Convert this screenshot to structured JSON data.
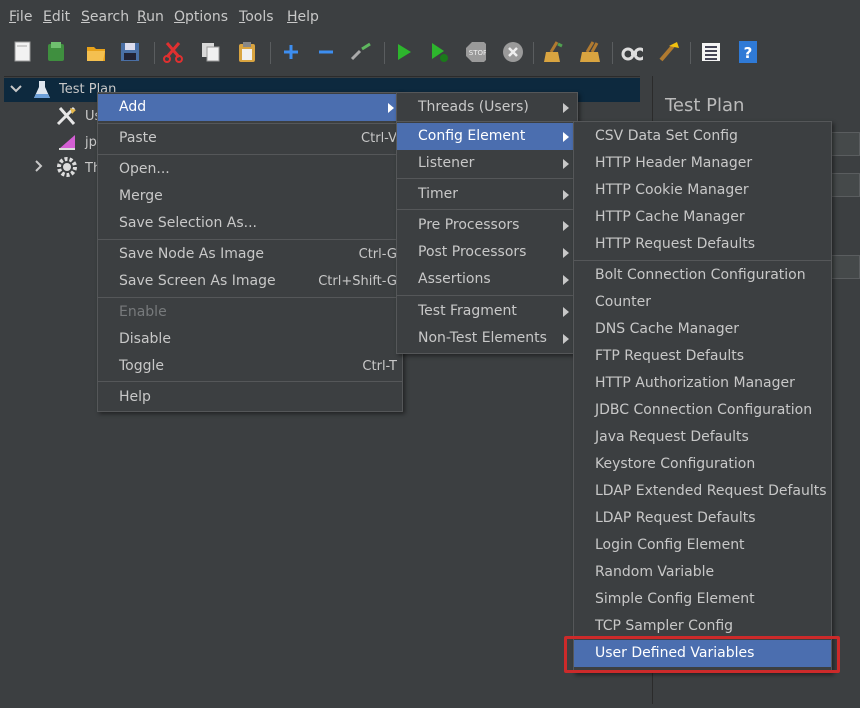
{
  "menubar": [
    "File",
    "Edit",
    "Search",
    "Run",
    "Options",
    "Tools",
    "Help"
  ],
  "toolbar_icons": [
    "new-icon",
    "templates-icon",
    "open-icon",
    "save-icon",
    "cut-icon",
    "copy-icon",
    "paste-icon",
    "expand-icon",
    "collapse-icon",
    "toggle-icon",
    "start-icon",
    "start-no-pause-icon",
    "stop-icon",
    "shutdown-icon",
    "clear-icon",
    "clear-all-icon",
    "search-icon",
    "reset-search-icon",
    "function-helper-icon",
    "help-icon"
  ],
  "tree": {
    "root": "Test Plan",
    "child1": "Us",
    "child2": "jp",
    "child3": "Th"
  },
  "right_pane": {
    "title": "Test Plan"
  },
  "context_menu": [
    {
      "label": "Add",
      "shortcut": "",
      "submenu": true,
      "highlight": true,
      "disabled": false
    },
    {
      "label": "Paste",
      "shortcut": "Ctrl-V",
      "submenu": false,
      "highlight": false,
      "disabled": false
    },
    {
      "label": "Open...",
      "shortcut": "",
      "submenu": false,
      "highlight": false,
      "disabled": false
    },
    {
      "label": "Merge",
      "shortcut": "",
      "submenu": false,
      "highlight": false,
      "disabled": false
    },
    {
      "label": "Save Selection As...",
      "shortcut": "",
      "submenu": false,
      "highlight": false,
      "disabled": false
    },
    {
      "label": "Save Node As Image",
      "shortcut": "Ctrl-G",
      "submenu": false,
      "highlight": false,
      "disabled": false
    },
    {
      "label": "Save Screen As Image",
      "shortcut": "Ctrl+Shift-G",
      "submenu": false,
      "highlight": false,
      "disabled": false
    },
    {
      "label": "Enable",
      "shortcut": "",
      "submenu": false,
      "highlight": false,
      "disabled": true
    },
    {
      "label": "Disable",
      "shortcut": "",
      "submenu": false,
      "highlight": false,
      "disabled": false
    },
    {
      "label": "Toggle",
      "shortcut": "Ctrl-T",
      "submenu": false,
      "highlight": false,
      "disabled": false
    },
    {
      "label": "Help",
      "shortcut": "",
      "submenu": false,
      "highlight": false,
      "disabled": false
    }
  ],
  "add_submenu": [
    {
      "label": "Threads (Users)",
      "highlight": false
    },
    {
      "label": "Config Element",
      "highlight": true
    },
    {
      "label": "Listener",
      "highlight": false
    },
    {
      "label": "Timer",
      "highlight": false
    },
    {
      "label": "Pre Processors",
      "highlight": false
    },
    {
      "label": "Post Processors",
      "highlight": false
    },
    {
      "label": "Assertions",
      "highlight": false
    },
    {
      "label": "Test Fragment",
      "highlight": false
    },
    {
      "label": "Non-Test Elements",
      "highlight": false
    }
  ],
  "config_submenu": [
    {
      "label": "CSV Data Set Config",
      "highlight": false
    },
    {
      "label": "HTTP Header Manager",
      "highlight": false
    },
    {
      "label": "HTTP Cookie Manager",
      "highlight": false
    },
    {
      "label": "HTTP Cache Manager",
      "highlight": false
    },
    {
      "label": "HTTP Request Defaults",
      "highlight": false
    },
    {
      "label": "Bolt Connection Configuration",
      "highlight": false
    },
    {
      "label": "Counter",
      "highlight": false
    },
    {
      "label": "DNS Cache Manager",
      "highlight": false
    },
    {
      "label": "FTP Request Defaults",
      "highlight": false
    },
    {
      "label": "HTTP Authorization Manager",
      "highlight": false
    },
    {
      "label": "JDBC Connection Configuration",
      "highlight": false
    },
    {
      "label": "Java Request Defaults",
      "highlight": false
    },
    {
      "label": "Keystore Configuration",
      "highlight": false
    },
    {
      "label": "LDAP Extended Request Defaults",
      "highlight": false
    },
    {
      "label": "LDAP Request Defaults",
      "highlight": false
    },
    {
      "label": "Login Config Element",
      "highlight": false
    },
    {
      "label": "Random Variable",
      "highlight": false
    },
    {
      "label": "Simple Config Element",
      "highlight": false
    },
    {
      "label": "TCP Sampler Config",
      "highlight": false
    },
    {
      "label": "User Defined Variables",
      "highlight": true
    }
  ],
  "colors": {
    "highlight": "#4b6eaf",
    "annotation": "#cc2a2a"
  }
}
